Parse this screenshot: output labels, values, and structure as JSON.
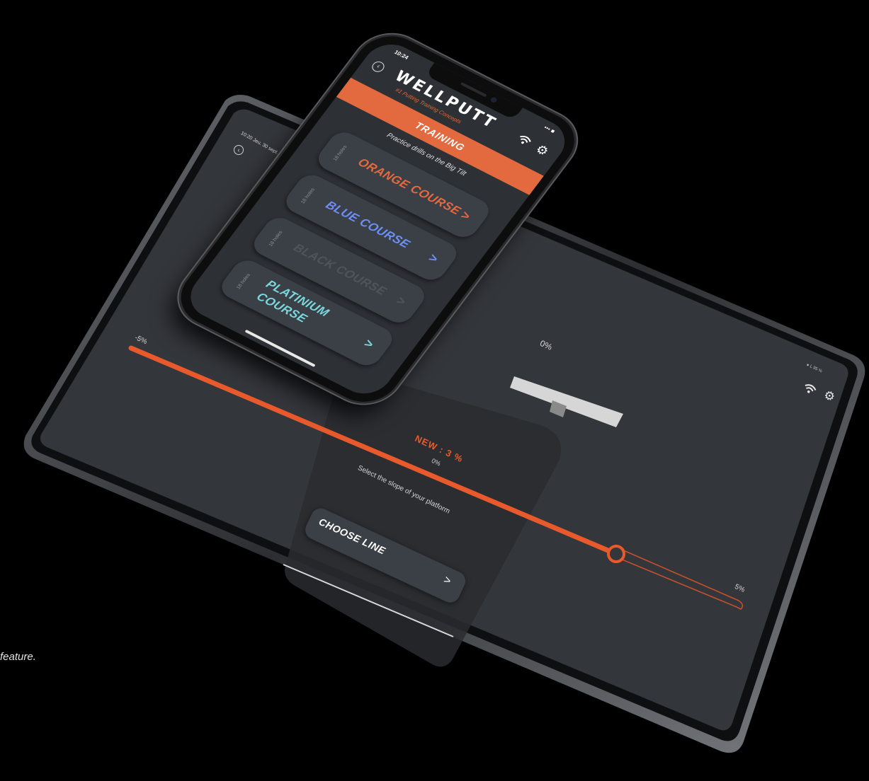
{
  "colors": {
    "accent": "#e3693e",
    "orange_course": "#e4693f",
    "blue_course": "#6d8ff5",
    "black_course": "#50545a",
    "platinium_course": "#79d8dd",
    "screen_bg": "#2d3035",
    "card_bg": "#3b3f46"
  },
  "tablet": {
    "time": "10:20  Jeu. 30 sept.",
    "status": "● L 95 %",
    "back_icon": "‹",
    "wifi_icon": "wifi-icon",
    "gear_icon": "gear-icon",
    "slider": {
      "min_label": "-5%",
      "max_label": "5%",
      "top_label": "0%",
      "value_fraction": 0.8
    },
    "new_slope": "NEW : 3 %",
    "current_slope": "0%",
    "instruction": "Select the slope of your platform",
    "choose_line": {
      "label": "CHOOSE LINE",
      "chevron": ">"
    }
  },
  "caption": "feature.",
  "phone": {
    "time": "10:24",
    "status": "••• ■",
    "back_icon": "‹",
    "logo": "WELLPUTT",
    "tagline": "#1 Putting Training Concepts",
    "screen_title": "TRAINING",
    "subtitle": "Practice drills on the Big Tilt",
    "courses": [
      {
        "holes": "18 holes",
        "name": "ORANGE COURSE",
        "chevron": ">"
      },
      {
        "holes": "18 holes",
        "name": "BLUE COURSE",
        "chevron": ">"
      },
      {
        "holes": "18 holes",
        "name": "BLACK COURSE",
        "chevron": ">"
      },
      {
        "holes": "18 holes",
        "name": "PLATINIUM COURSE",
        "chevron": ">"
      }
    ]
  }
}
